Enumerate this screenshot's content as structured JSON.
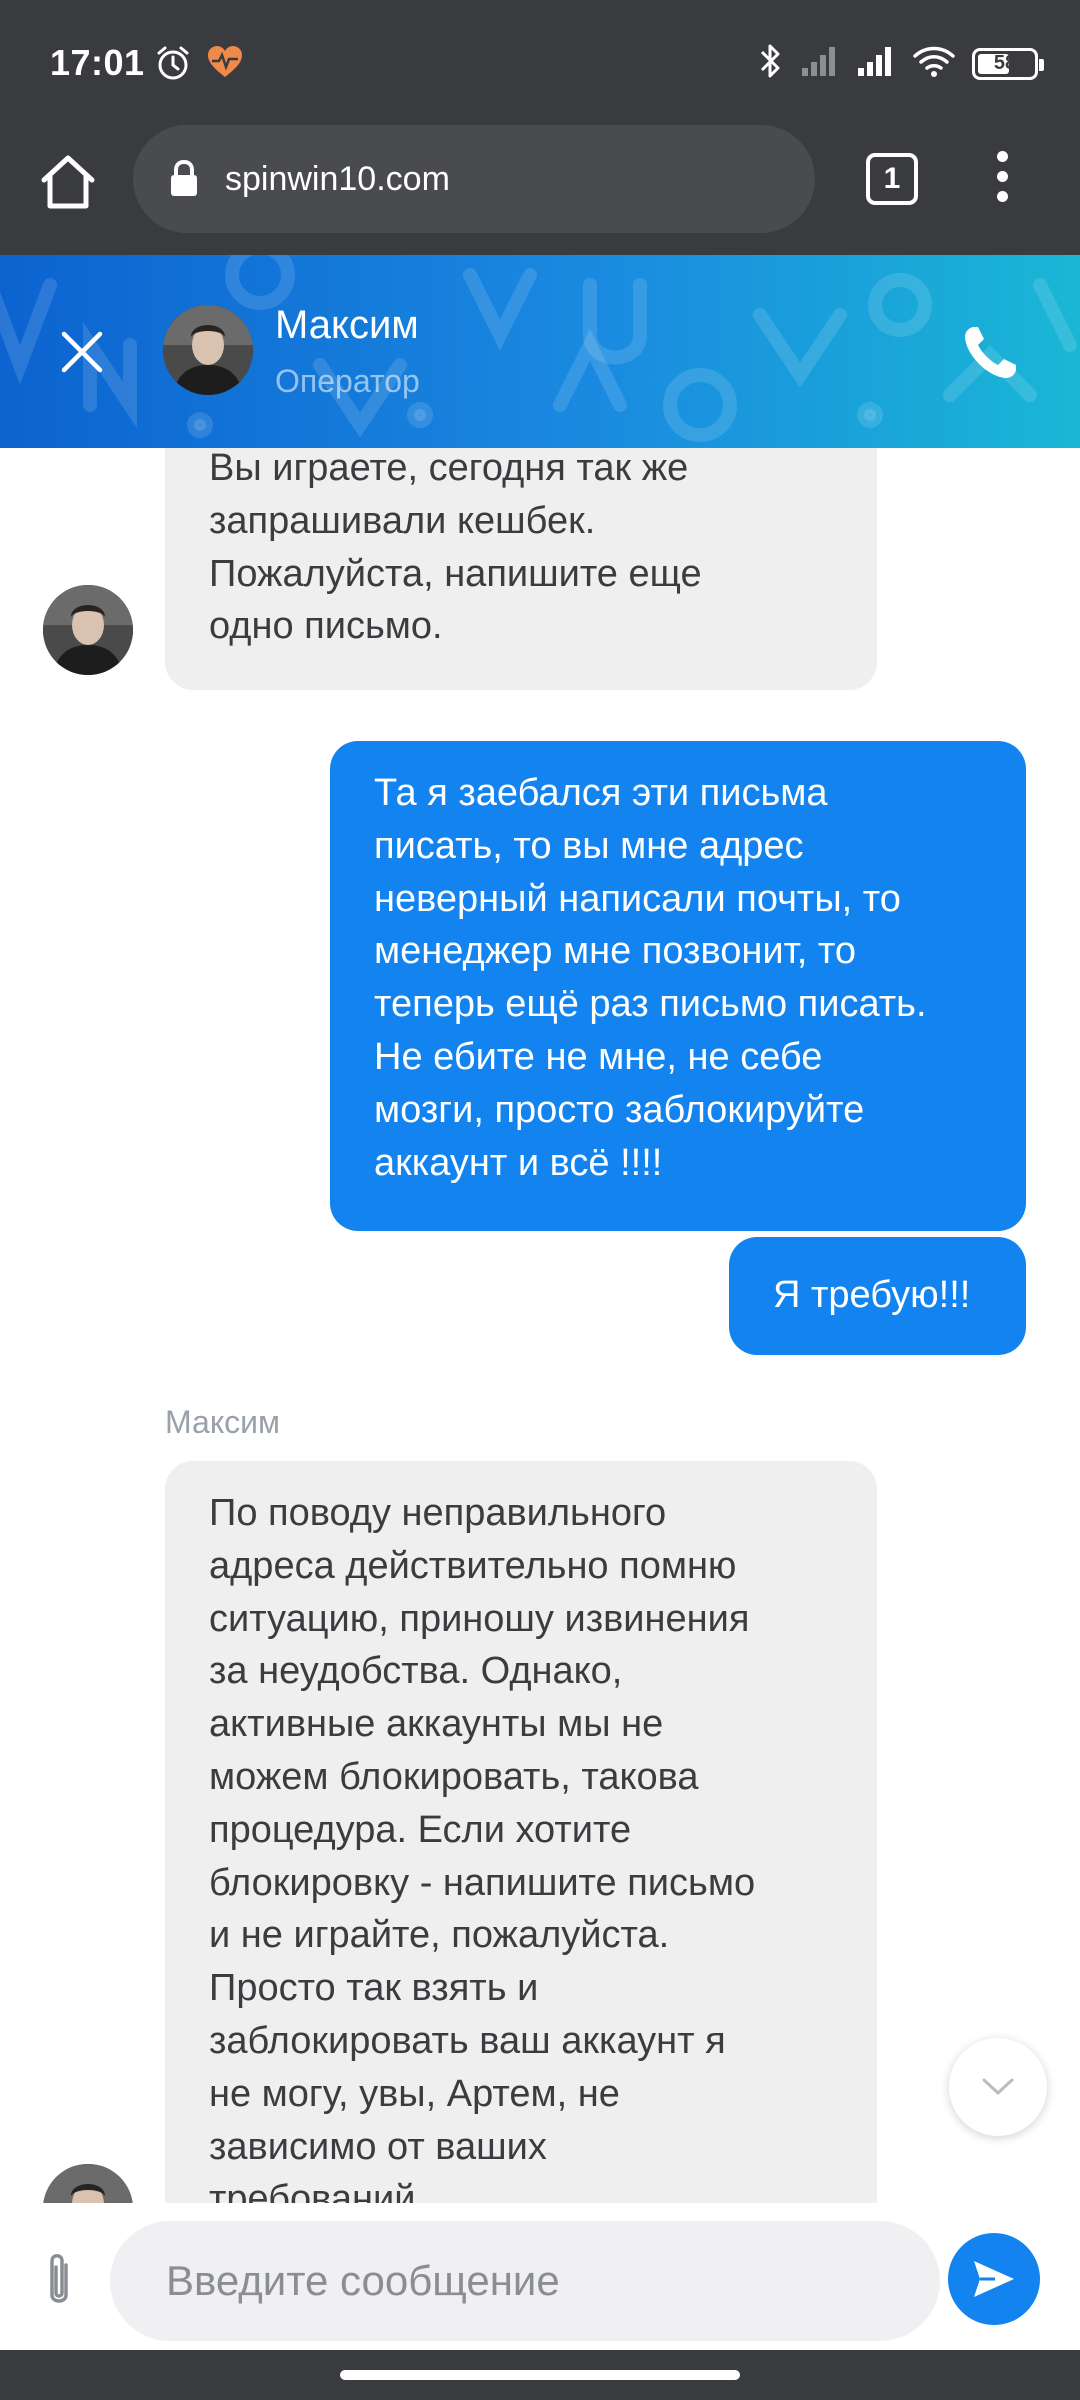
{
  "status_bar": {
    "time": "17:01",
    "battery": "58",
    "battery_level": 0.58
  },
  "browser": {
    "url": "spinwin10.com",
    "tab_count": "1"
  },
  "chat_header": {
    "operator_name": "Максим",
    "operator_role": "Оператор"
  },
  "messages": [
    {
      "from": "operator",
      "lines": [
        "Вы играете, сегодня так же",
        "запрашивали кешбек.",
        "Пожалуйста, напишите еще",
        "одно письмо."
      ]
    },
    {
      "from": "user",
      "lines": [
        "Та я заебался эти письма",
        "писать, то вы мне адрес",
        "неверный написали почты, то",
        "менеджер мне позвонит, то",
        "теперь ещё раз письмо писать.",
        "Не ебите не мне, не себе",
        "мозги, просто заблокируйте",
        "аккаунт и всё !!!!"
      ]
    },
    {
      "from": "user",
      "lines": [
        "Я требую!!!"
      ]
    },
    {
      "from": "operator",
      "sender": "Максим",
      "lines": [
        "По поводу неправильного",
        "адреса действительно помню",
        "ситуацию, приношу извинения",
        "за неудобства. Однако,",
        "активные аккаунты мы не",
        "можем блокировать, такова",
        "процедура. Если хотите",
        "блокировку - напишите письмо",
        "и не играйте, пожалуйста.",
        "Просто так взять и",
        "заблокировать ваш аккаунт я",
        "не могу, увы, Артем, не",
        "зависимо от ваших",
        "требований"
      ]
    }
  ],
  "input": {
    "placeholder": "Введите сообщение"
  },
  "colors": {
    "accent": "#1283ef",
    "incoming_bubble": "#efefef",
    "system_bar": "#3a3b3e"
  }
}
